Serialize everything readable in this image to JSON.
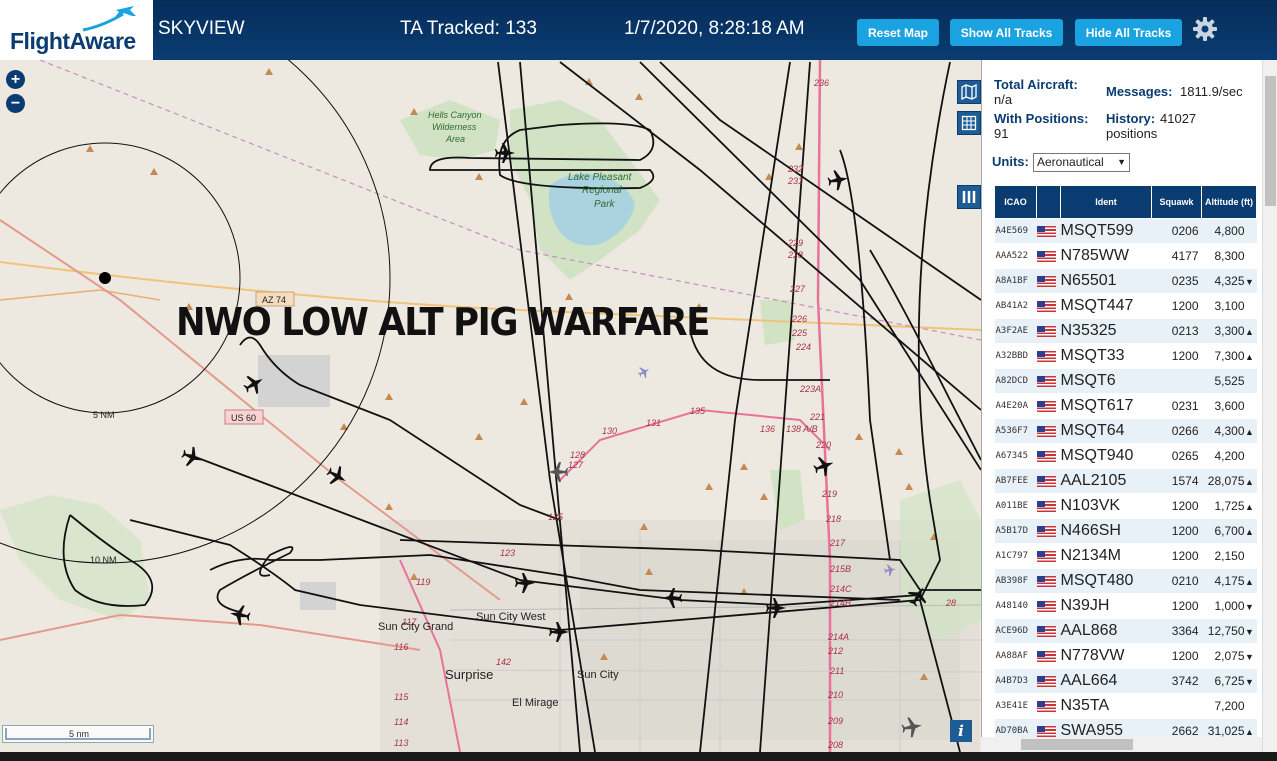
{
  "header": {
    "logo_text": "FlightAware",
    "site_name": "SKYVIEW",
    "tracked": "TA Tracked: 133",
    "datetime": "1/7/2020, 8:28:18 AM",
    "buttons": [
      "Reset Map",
      "Show All Tracks",
      "Hide All Tracks"
    ],
    "accent_color": "#1aa3e0",
    "bar_color": "#0a3c72"
  },
  "map": {
    "overlay_text": "NWO LOW ALT PIG WARFARE",
    "zoom_in": "+",
    "zoom_out": "−",
    "scale_label": "5 nm",
    "info_label": "i",
    "labels": {
      "hells_canyon": [
        "Hells Canyon",
        "Wilderness",
        "Area"
      ],
      "lake_pleasant": [
        "Lake Pleasant",
        "Regional",
        "Park"
      ],
      "az74": "AZ 74",
      "us60": "US 60",
      "ring5": "5 NM",
      "ring10": "10 NM",
      "sun_city_grand": "Sun City Grand",
      "sun_city_west": "Sun City West",
      "sun_city": "Sun City",
      "surprise": "Surprise",
      "el_mirage": "El Mirage"
    },
    "route_numbers": [
      "236",
      "232",
      "231",
      "229",
      "228",
      "227",
      "226",
      "225",
      "224",
      "223",
      "223A",
      "221",
      "220",
      "219",
      "218",
      "217",
      "215B",
      "214C",
      "214B",
      "214A",
      "212",
      "211",
      "210",
      "209",
      "208",
      "135",
      "136",
      "138 A/B",
      "131",
      "130",
      "128",
      "127",
      "125",
      "123",
      "119",
      "117",
      "116",
      "115",
      "114",
      "113",
      "142",
      "28"
    ]
  },
  "stats": {
    "total_aircraft_label": "Total Aircraft:",
    "total_aircraft_value": "n/a",
    "messages_label": "Messages:",
    "messages_value": "1811.9/sec",
    "with_positions_label": "With Positions:",
    "with_positions_value": "91",
    "history_label": "History:",
    "history_value": "41027",
    "history_unit": "positions",
    "units_label": "Units:",
    "units_value": "Aeronautical"
  },
  "table": {
    "headers": [
      "ICAO",
      "",
      "Ident",
      "Squawk",
      "Altitude (ft)"
    ],
    "rows": [
      {
        "icao": "A4E569",
        "ident": "MSQT599",
        "squawk": "0206",
        "alt": "4,800",
        "trend": ""
      },
      {
        "icao": "AAA522",
        "ident": "N785WW",
        "squawk": "4177",
        "alt": "8,300",
        "trend": ""
      },
      {
        "icao": "A8A1BF",
        "ident": "N65501",
        "squawk": "0235",
        "alt": "4,325",
        "trend": "▼"
      },
      {
        "icao": "AB41A2",
        "ident": "MSQT447",
        "squawk": "1200",
        "alt": "3,100",
        "trend": ""
      },
      {
        "icao": "A3F2AE",
        "ident": "N35325",
        "squawk": "0213",
        "alt": "3,300",
        "trend": "▲"
      },
      {
        "icao": "A32BBD",
        "ident": "MSQT33",
        "squawk": "1200",
        "alt": "7,300",
        "trend": "▲"
      },
      {
        "icao": "A82DCD",
        "ident": "MSQT6",
        "squawk": "",
        "alt": "5,525",
        "trend": ""
      },
      {
        "icao": "A4E20A",
        "ident": "MSQT617",
        "squawk": "0231",
        "alt": "3,600",
        "trend": ""
      },
      {
        "icao": "A536F7",
        "ident": "MSQT64",
        "squawk": "0266",
        "alt": "4,300",
        "trend": "▲"
      },
      {
        "icao": "A67345",
        "ident": "MSQT940",
        "squawk": "0265",
        "alt": "4,200",
        "trend": ""
      },
      {
        "icao": "AB7FEE",
        "ident": "AAL2105",
        "squawk": "1574",
        "alt": "28,075",
        "trend": "▲"
      },
      {
        "icao": "A011BE",
        "ident": "N103VK",
        "squawk": "1200",
        "alt": "1,725",
        "trend": "▲"
      },
      {
        "icao": "A5B17D",
        "ident": "N466SH",
        "squawk": "1200",
        "alt": "6,700",
        "trend": "▲"
      },
      {
        "icao": "A1C797",
        "ident": "N2134M",
        "squawk": "1200",
        "alt": "2,150",
        "trend": ""
      },
      {
        "icao": "AB398F",
        "ident": "MSQT480",
        "squawk": "0210",
        "alt": "4,175",
        "trend": "▲"
      },
      {
        "icao": "A48140",
        "ident": "N39JH",
        "squawk": "1200",
        "alt": "1,000",
        "trend": "▼"
      },
      {
        "icao": "ACE96D",
        "ident": "AAL868",
        "squawk": "3364",
        "alt": "12,750",
        "trend": "▼"
      },
      {
        "icao": "AA88AF",
        "ident": "N778VW",
        "squawk": "1200",
        "alt": "2,075",
        "trend": "▼"
      },
      {
        "icao": "A4B7D3",
        "ident": "AAL664",
        "squawk": "3742",
        "alt": "6,725",
        "trend": "▼"
      },
      {
        "icao": "A3E41E",
        "ident": "N35TA",
        "squawk": "",
        "alt": "7,200",
        "trend": ""
      },
      {
        "icao": "AD70BA",
        "ident": "SWA955",
        "squawk": "2662",
        "alt": "31,025",
        "trend": "▲"
      }
    ]
  }
}
